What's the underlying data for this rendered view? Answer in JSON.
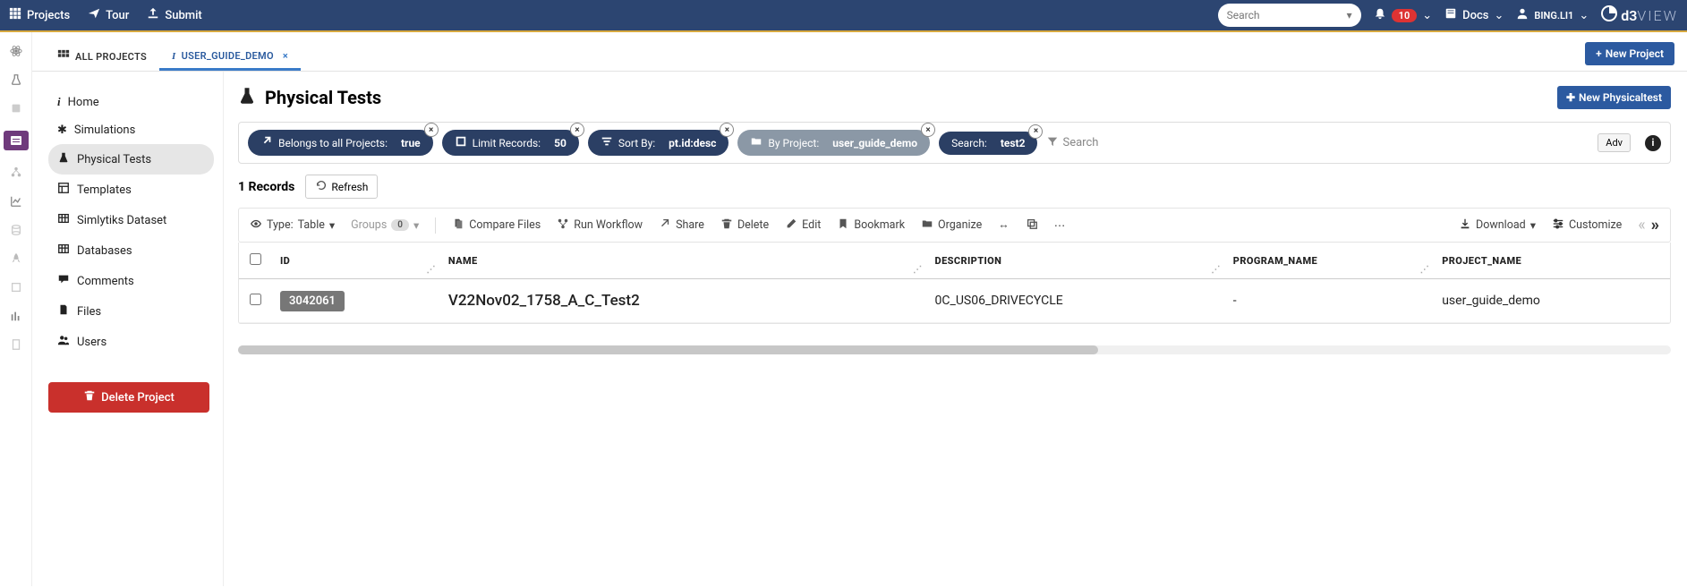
{
  "topbar": {
    "projects": "Projects",
    "tour": "Tour",
    "submit": "Submit",
    "search_placeholder": "Search",
    "notif_count": "10",
    "docs": "Docs",
    "username": "BING.LI1",
    "logo_d3": "d3",
    "logo_view": "VIEW"
  },
  "tabs": {
    "all_projects": "All Projects",
    "current": "USER_GUIDE_DEMO",
    "new_project": "New Project"
  },
  "sidebar": {
    "items": [
      {
        "label": "Home"
      },
      {
        "label": "Simulations"
      },
      {
        "label": "Physical Tests"
      },
      {
        "label": "Templates"
      },
      {
        "label": "Simlytiks Dataset"
      },
      {
        "label": "Databases"
      },
      {
        "label": "Comments"
      },
      {
        "label": "Files"
      },
      {
        "label": "Users"
      }
    ],
    "delete": "Delete Project"
  },
  "page": {
    "title": "Physical Tests",
    "new_btn": "New Physicaltest"
  },
  "filters": {
    "belongs_label": "Belongs to all Projects:",
    "belongs_val": "true",
    "limit_label": "Limit Records:",
    "limit_val": "50",
    "sort_label": "Sort By:",
    "sort_val": "pt.id:desc",
    "byproj_label": "By Project:",
    "byproj_val": "user_guide_demo",
    "search_label": "Search:",
    "search_val": "test2",
    "search_text": "Search",
    "adv": "Adv"
  },
  "records": {
    "count_label": "1 Records",
    "refresh": "Refresh"
  },
  "toolbar": {
    "type_label": "Type:",
    "type_val": "Table",
    "groups": "Groups",
    "groups_count": "0",
    "compare": "Compare Files",
    "workflow": "Run Workflow",
    "share": "Share",
    "delete": "Delete",
    "edit": "Edit",
    "bookmark": "Bookmark",
    "organize": "Organize",
    "download": "Download",
    "customize": "Customize"
  },
  "columns": [
    "ID",
    "NAME",
    "DESCRIPTION",
    "PROGRAM_NAME",
    "PROJECT_NAME"
  ],
  "rows": [
    {
      "id": "3042061",
      "name": "V22Nov02_1758_A_C_Test2",
      "description": "0C_US06_DRIVECYCLE",
      "program_name": "-",
      "project_name": "user_guide_demo"
    }
  ]
}
